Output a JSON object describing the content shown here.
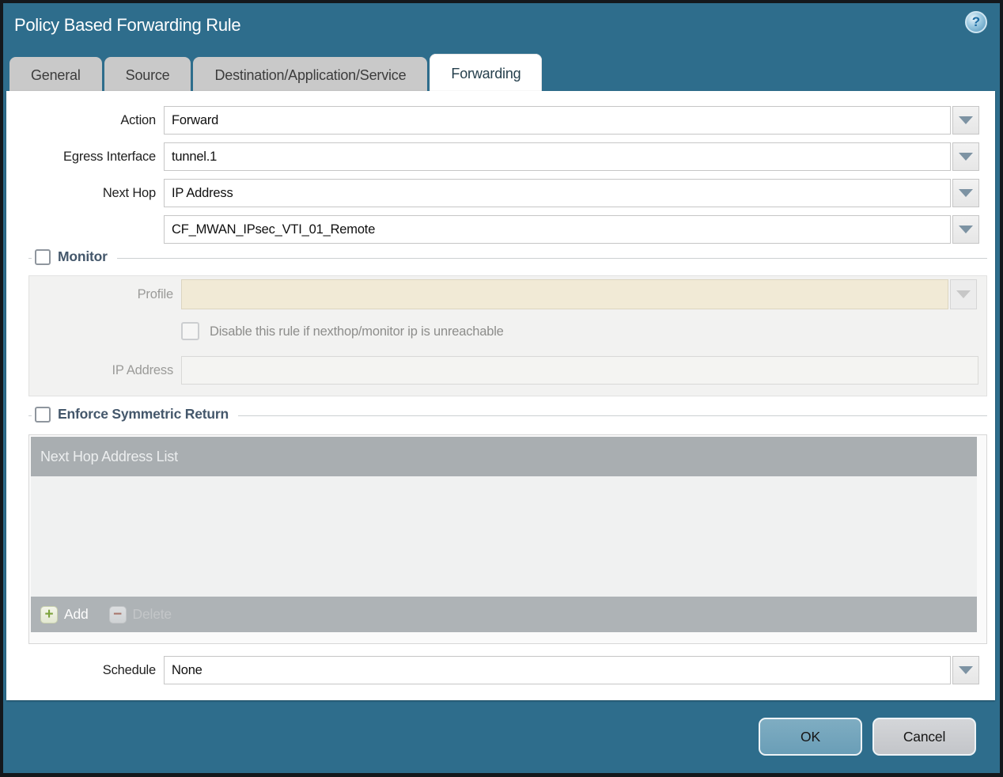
{
  "dialog": {
    "title": "Policy Based Forwarding Rule"
  },
  "icons": {
    "help": "?",
    "add": "+",
    "delete": "−"
  },
  "tabs": [
    {
      "label": "General",
      "active": false
    },
    {
      "label": "Source",
      "active": false
    },
    {
      "label": "Destination/Application/Service",
      "active": false
    },
    {
      "label": "Forwarding",
      "active": true
    }
  ],
  "form": {
    "action": {
      "label": "Action",
      "value": "Forward"
    },
    "egress_interface": {
      "label": "Egress Interface",
      "value": "tunnel.1"
    },
    "next_hop": {
      "label": "Next Hop",
      "value": "IP Address"
    },
    "next_hop_address": {
      "value": "CF_MWAN_IPsec_VTI_01_Remote"
    },
    "schedule": {
      "label": "Schedule",
      "value": "None"
    }
  },
  "monitor": {
    "legend": "Monitor",
    "checked": false,
    "profile": {
      "label": "Profile",
      "value": ""
    },
    "disable_rule": {
      "label": "Disable this rule if nexthop/monitor ip is unreachable",
      "checked": false
    },
    "ip_address": {
      "label": "IP Address",
      "value": ""
    }
  },
  "symmetric_return": {
    "legend": "Enforce Symmetric Return",
    "checked": false,
    "table": {
      "header": "Next Hop Address List",
      "rows": []
    },
    "toolbar": {
      "add_label": "Add",
      "delete_label": "Delete",
      "delete_enabled": false
    }
  },
  "footer": {
    "ok_label": "OK",
    "cancel_label": "Cancel"
  },
  "colors": {
    "titlebar_teal": "#2e6d8c",
    "active_tab_text": "#26404d",
    "legend_text": "#44576b",
    "grid_header_gray": "#a9aeb1",
    "profile_cream": "#f1ead6",
    "ok_button_blue": "#74a6bc",
    "add_green": "#7da33c",
    "delete_red": "#a8766c"
  }
}
